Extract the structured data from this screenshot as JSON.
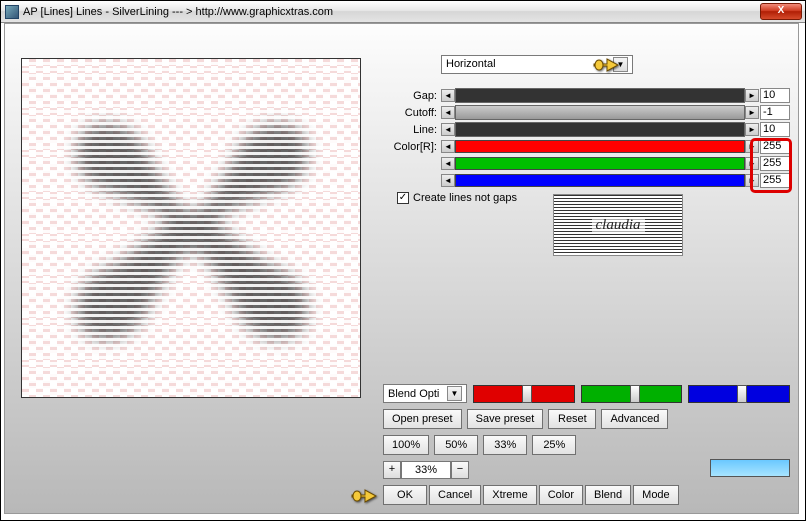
{
  "titlebar": {
    "title": "AP [Lines]  Lines - SilverLining   --- >  http://www.graphicxtras.com",
    "close": "X"
  },
  "dropdown": {
    "value": "Horizontal"
  },
  "sliders": {
    "gap": {
      "label": "Gap:",
      "value": "10"
    },
    "cutoff": {
      "label": "Cutoff:",
      "value": "-1"
    },
    "line": {
      "label": "Line:",
      "value": "10"
    },
    "colorR": {
      "label": "Color[R]:",
      "value": "255"
    },
    "colorG": {
      "label": "",
      "value": "255"
    },
    "colorB": {
      "label": "",
      "value": "255"
    }
  },
  "checkbox": {
    "label": "Create lines not gaps",
    "checked": true
  },
  "logo": {
    "text": "claudia"
  },
  "blend": {
    "dropdown": "Blend Opti"
  },
  "buttons": {
    "open": "Open preset",
    "save": "Save preset",
    "reset": "Reset",
    "advanced": "Advanced",
    "p100": "100%",
    "p50": "50%",
    "p33": "33%",
    "p25": "25%",
    "ok": "OK",
    "cancel": "Cancel",
    "xtreme": "Xtreme",
    "color": "Color",
    "blendb": "Blend",
    "mode": "Mode"
  },
  "zoom": {
    "plus": "+",
    "value": "33%",
    "minus": "−"
  }
}
